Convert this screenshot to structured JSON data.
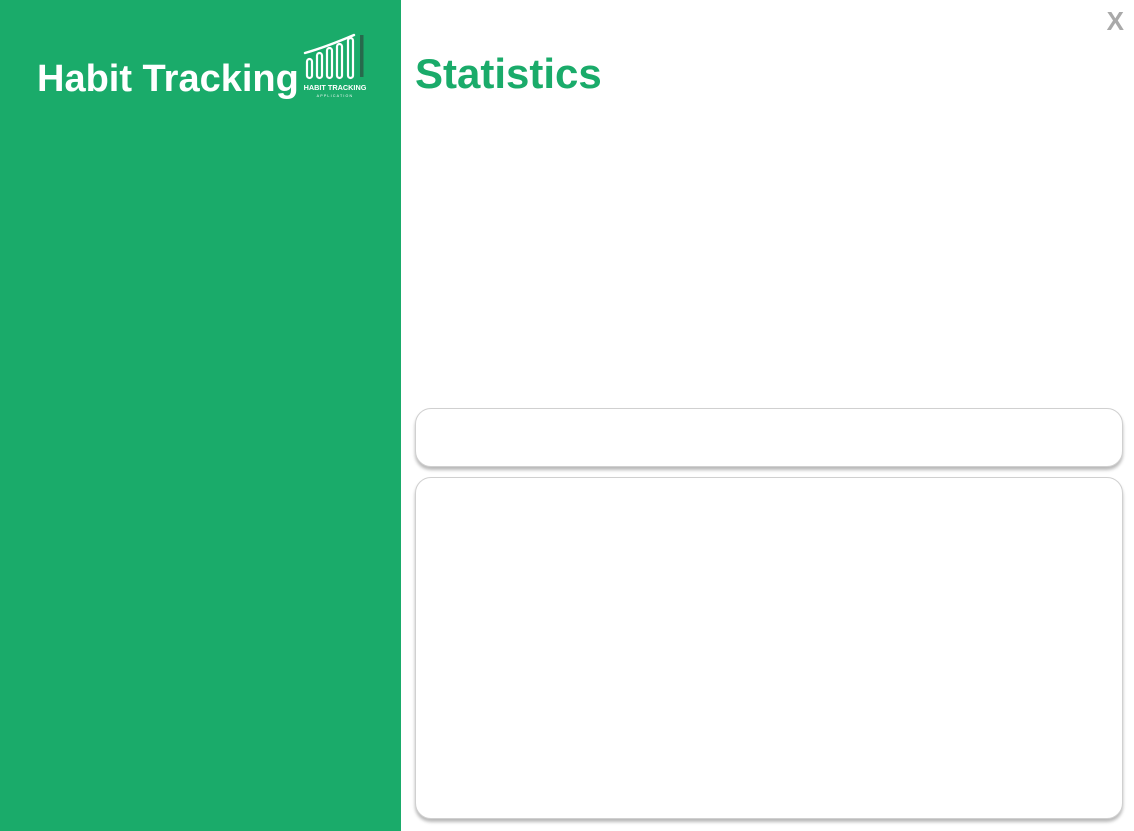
{
  "sidebar": {
    "title": "Habit Tracking",
    "logo": {
      "icon": "bar-chart-logo-icon",
      "text": "HABIT TRACKING",
      "subtext": "APPLICATION"
    }
  },
  "main": {
    "title": "Statistics",
    "close_label": "X"
  },
  "colors": {
    "brand_green": "#1aab6a",
    "close_gray": "#a9a9a9",
    "card_border": "#d0d0d0"
  }
}
